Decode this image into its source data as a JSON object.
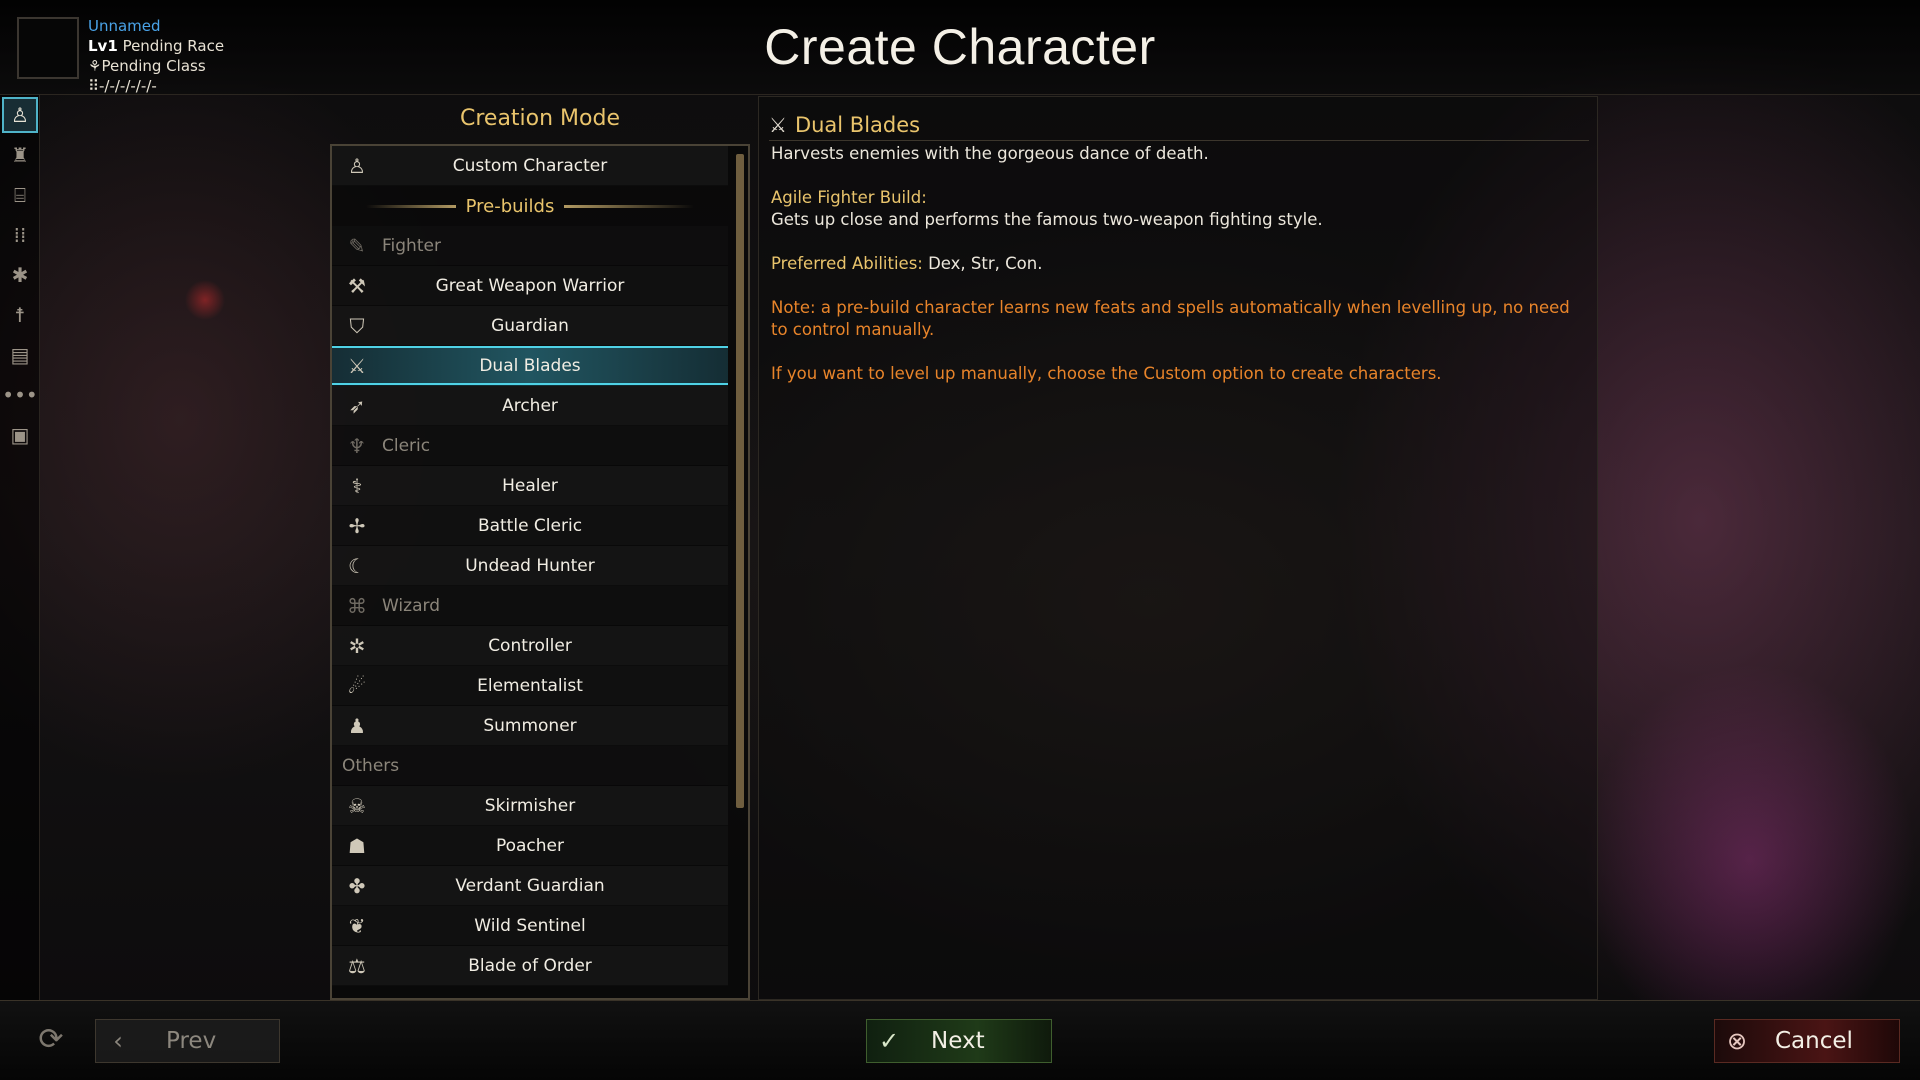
{
  "header": {
    "title": "Create Character",
    "character": {
      "name": "Unnamed",
      "level": "Lv1",
      "race": "Pending Race",
      "class": "Pending Class",
      "abilities": "-/-/-/-/-/-"
    }
  },
  "sidebar": {
    "items": [
      {
        "icon": "person-icon",
        "active": true
      },
      {
        "icon": "armored-figure-icon"
      },
      {
        "icon": "open-book-stand-icon"
      },
      {
        "icon": "grid-dots-icon"
      },
      {
        "icon": "figure-stars-icon"
      },
      {
        "icon": "figure-arms-icon"
      },
      {
        "icon": "spellbook-icon"
      },
      {
        "icon": "more-dots-icon"
      },
      {
        "icon": "id-card-icon"
      }
    ]
  },
  "creation_mode": {
    "title": "Creation Mode",
    "custom": "Custom Character",
    "prebuilds_label": "Pre-builds",
    "rows": [
      {
        "type": "header",
        "label": "Fighter",
        "icon": "quill-sword-icon"
      },
      {
        "type": "item",
        "label": "Great Weapon Warrior",
        "icon": "axe-icon"
      },
      {
        "type": "item",
        "label": "Guardian",
        "icon": "shield-icon"
      },
      {
        "type": "item",
        "label": "Dual Blades",
        "icon": "crossed-swords-icon",
        "selected": true
      },
      {
        "type": "item",
        "label": "Archer",
        "icon": "bow-icon"
      },
      {
        "type": "header",
        "label": "Cleric",
        "icon": "winged-helm-icon"
      },
      {
        "type": "item",
        "label": "Healer",
        "icon": "caduceus-icon"
      },
      {
        "type": "item",
        "label": "Battle Cleric",
        "icon": "mace-icon"
      },
      {
        "type": "item",
        "label": "Undead Hunter",
        "icon": "scythe-icon"
      },
      {
        "type": "header",
        "label": "Wizard",
        "icon": "magic-book-icon"
      },
      {
        "type": "item",
        "label": "Controller",
        "icon": "marionette-icon"
      },
      {
        "type": "item",
        "label": "Elementalist",
        "icon": "fireball-icon"
      },
      {
        "type": "item",
        "label": "Summoner",
        "icon": "group-icon"
      },
      {
        "type": "other",
        "label": "Others"
      },
      {
        "type": "item",
        "label": "Skirmisher",
        "icon": "hooded-blades-icon"
      },
      {
        "type": "item",
        "label": "Poacher",
        "icon": "hooded-figure-icon"
      },
      {
        "type": "item",
        "label": "Verdant Guardian",
        "icon": "leaf-blades-icon"
      },
      {
        "type": "item",
        "label": "Wild Sentinel",
        "icon": "leaf-bow-icon"
      },
      {
        "type": "item",
        "label": "Blade of Order",
        "icon": "scales-icon"
      }
    ]
  },
  "description": {
    "title": "Dual Blades",
    "intro": "Harvests enemies with the gorgeous dance of death.",
    "build_label": "Agile Fighter Build:",
    "build_text": "Gets up close and performs the famous two-weapon fighting style.",
    "abilities_label": "Preferred Abilities:",
    "abilities_text": " Dex, Str, Con.",
    "note": "Note: a pre-build character learns new feats and spells automatically when levelling up, no need to control manually.",
    "manual_hint": "If you want to level up manually, choose the Custom option to create characters."
  },
  "footer": {
    "prev_label": "Prev",
    "next_label": "Next",
    "cancel_label": "Cancel"
  },
  "colors": {
    "accent_gold": "#e9c46c",
    "note_orange": "#e8842a",
    "selected_cyan": "#4fd2e6",
    "name_blue": "#4aa3e8"
  }
}
